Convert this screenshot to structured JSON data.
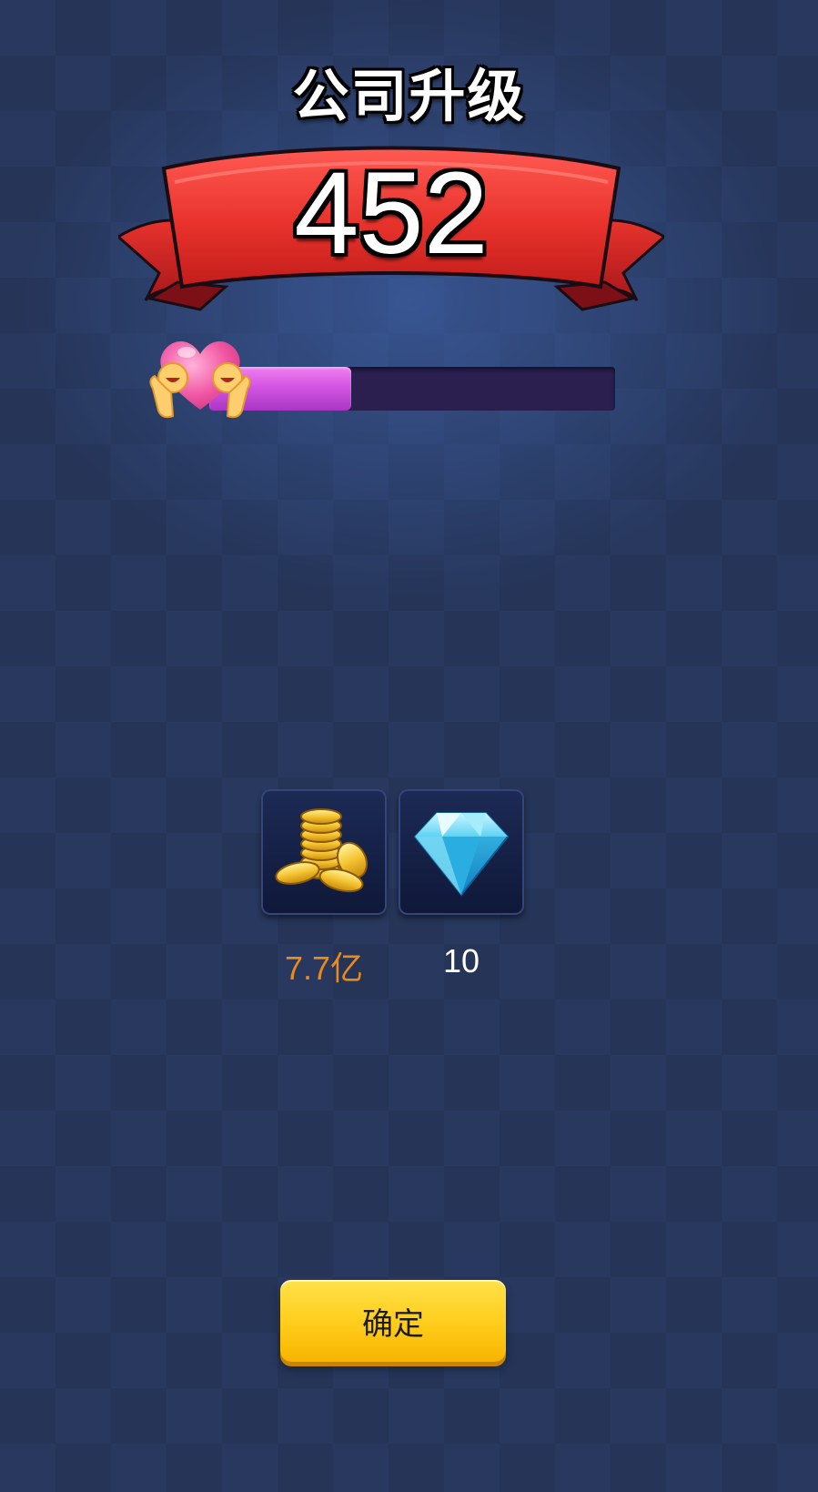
{
  "header": {
    "title": "公司升级"
  },
  "level_banner": {
    "level": "452",
    "ribbon_color": "#e8322c"
  },
  "progress": {
    "fraction": 0.35,
    "fill_color": "#d356e3",
    "badge_icon": "heart-hug-icon"
  },
  "rewards": [
    {
      "icon": "gold-coins-icon",
      "label": "7.7亿",
      "color": "#e98a1c"
    },
    {
      "icon": "diamond-icon",
      "label": "10",
      "color": "#ffffff"
    }
  ],
  "actions": {
    "confirm_label": "确定",
    "confirm_color": "#ffcc1a"
  }
}
